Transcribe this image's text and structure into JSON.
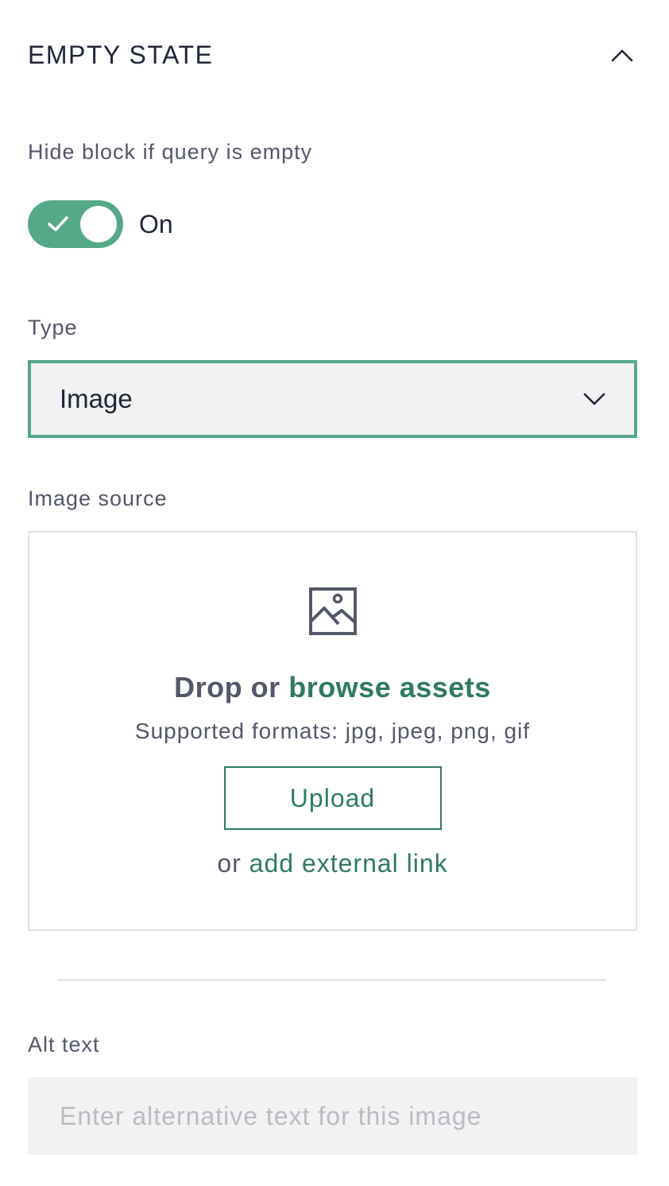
{
  "section": {
    "title": "EMPTY STATE",
    "collapse_icon": "chevron-up-icon"
  },
  "hide_block": {
    "label": "Hide block if query is empty",
    "state_label": "On",
    "enabled": true,
    "accent_color": "#55a888"
  },
  "type_field": {
    "label": "Type",
    "selected": "Image",
    "icon": "chevron-down-icon"
  },
  "image_source": {
    "label": "Image source",
    "icon": "image-icon",
    "drop_prefix": "Drop or",
    "browse_link": "browse assets",
    "formats": "Supported formats: jpg, jpeg, png, gif",
    "upload_label": "Upload",
    "external_prefix": "or",
    "external_link": "add external link",
    "link_color": "#2f7a64"
  },
  "alt_text": {
    "label": "Alt text",
    "value": "",
    "placeholder": "Enter alternative text for this image"
  }
}
